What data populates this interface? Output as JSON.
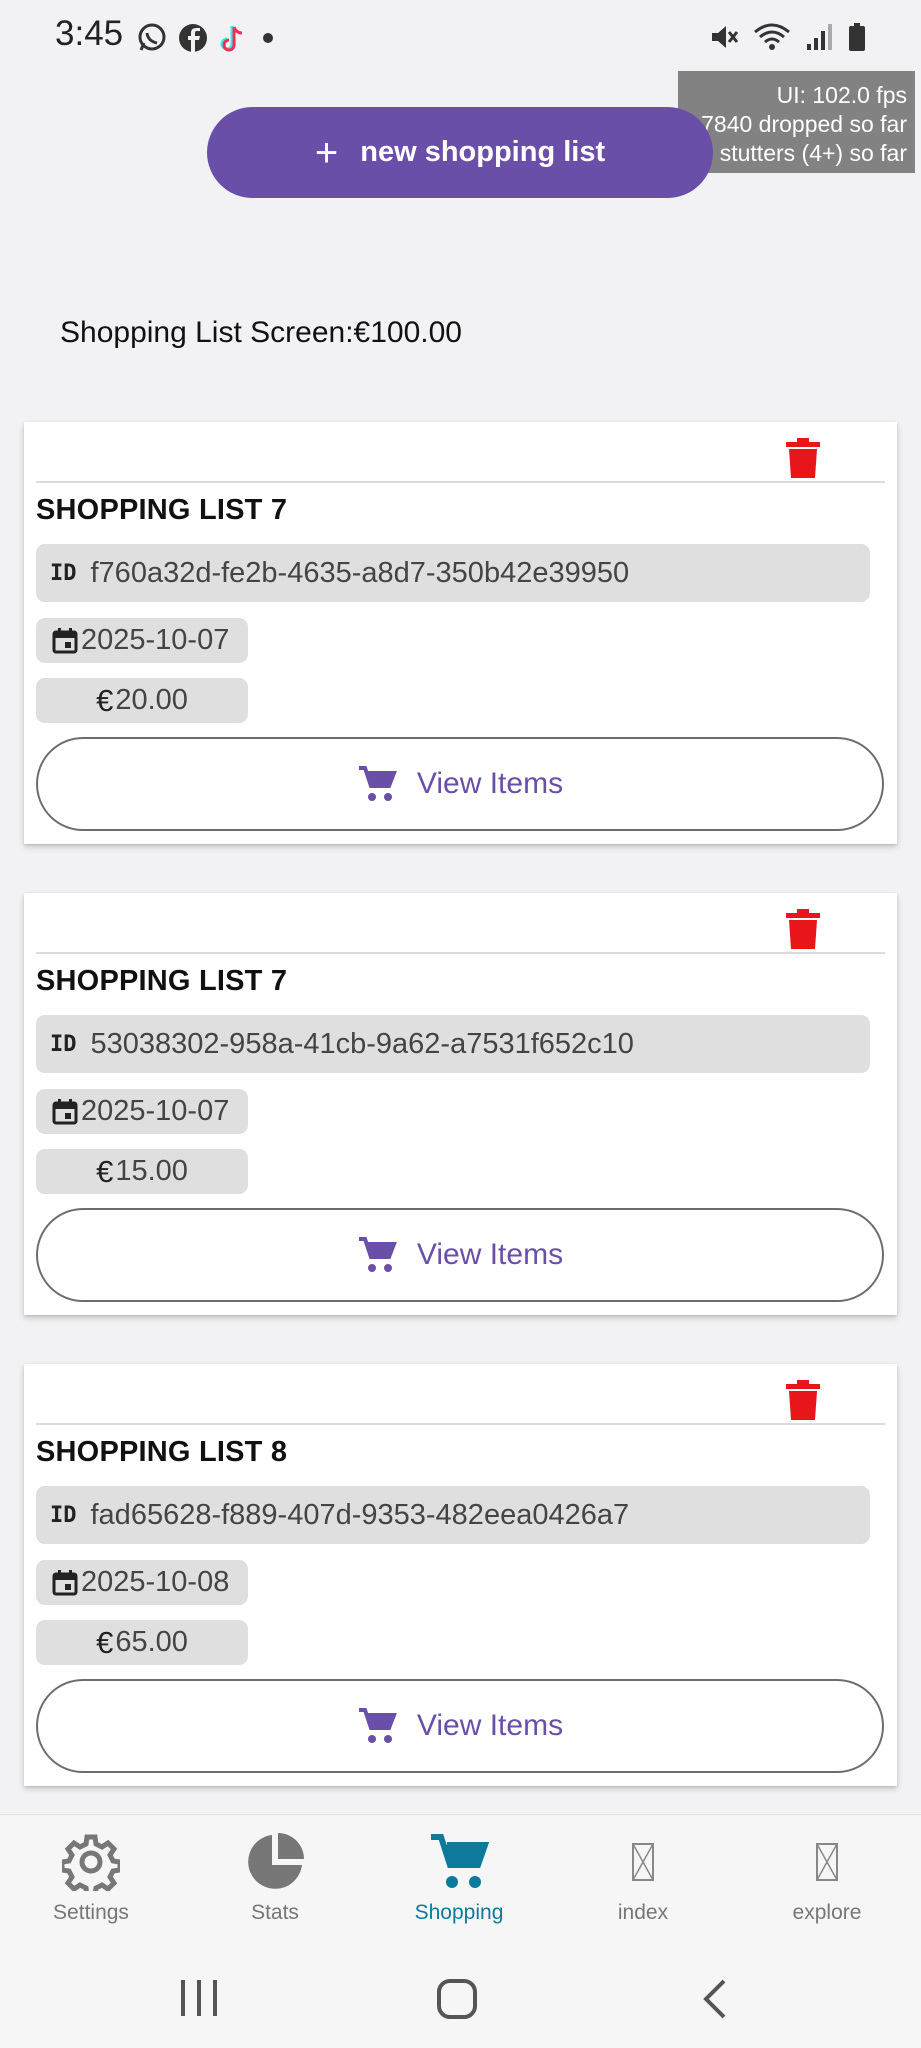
{
  "status_bar": {
    "time": "3:45",
    "app_icons": [
      "whatsapp-icon",
      "facebook-icon",
      "tiktok-icon",
      "dot-icon"
    ],
    "system_icons": [
      "mute-icon",
      "wifi-icon",
      "signal-icon",
      "battery-icon"
    ]
  },
  "fps_overlay": {
    "line1": "UI: 102.0 fps",
    "line2": "-7840 dropped so far",
    "line3": "0 stutters (4+) so far"
  },
  "new_list_button": {
    "icon": "+",
    "label": "new shopping list"
  },
  "screen_title": "Shopping List Screen:€100.00",
  "lists": [
    {
      "title": "SHOPPING LIST 7",
      "id_tag": "ID",
      "id": "f760a32d-fe2b-4635-a8d7-350b42e39950",
      "date": "2025-10-07",
      "price": "20.00",
      "euro": "€",
      "view_label": "View Items"
    },
    {
      "title": "SHOPPING LIST 7",
      "id_tag": "ID",
      "id": "53038302-958a-41cb-9a62-a7531f652c10",
      "date": "2025-10-07",
      "price": "15.00",
      "euro": "€",
      "view_label": "View Items"
    },
    {
      "title": "SHOPPING LIST 8",
      "id_tag": "ID",
      "id": "fad65628-f889-407d-9353-482eea0426a7",
      "date": "2025-10-08",
      "price": "65.00",
      "euro": "€",
      "view_label": "View Items"
    }
  ],
  "bottom_nav": {
    "items": [
      {
        "label": "Settings",
        "icon": "gear-icon"
      },
      {
        "label": "Stats",
        "icon": "pie-chart-icon"
      },
      {
        "label": "Shopping",
        "icon": "cart-icon",
        "active": true
      },
      {
        "label": "index",
        "icon": "missing-glyph-icon"
      },
      {
        "label": "explore",
        "icon": "missing-glyph-icon"
      }
    ]
  },
  "colors": {
    "accent": "#6a4fa8",
    "active_tab": "#0d7a9c",
    "delete": "#e8151b",
    "chip": "#e0dfdf"
  }
}
